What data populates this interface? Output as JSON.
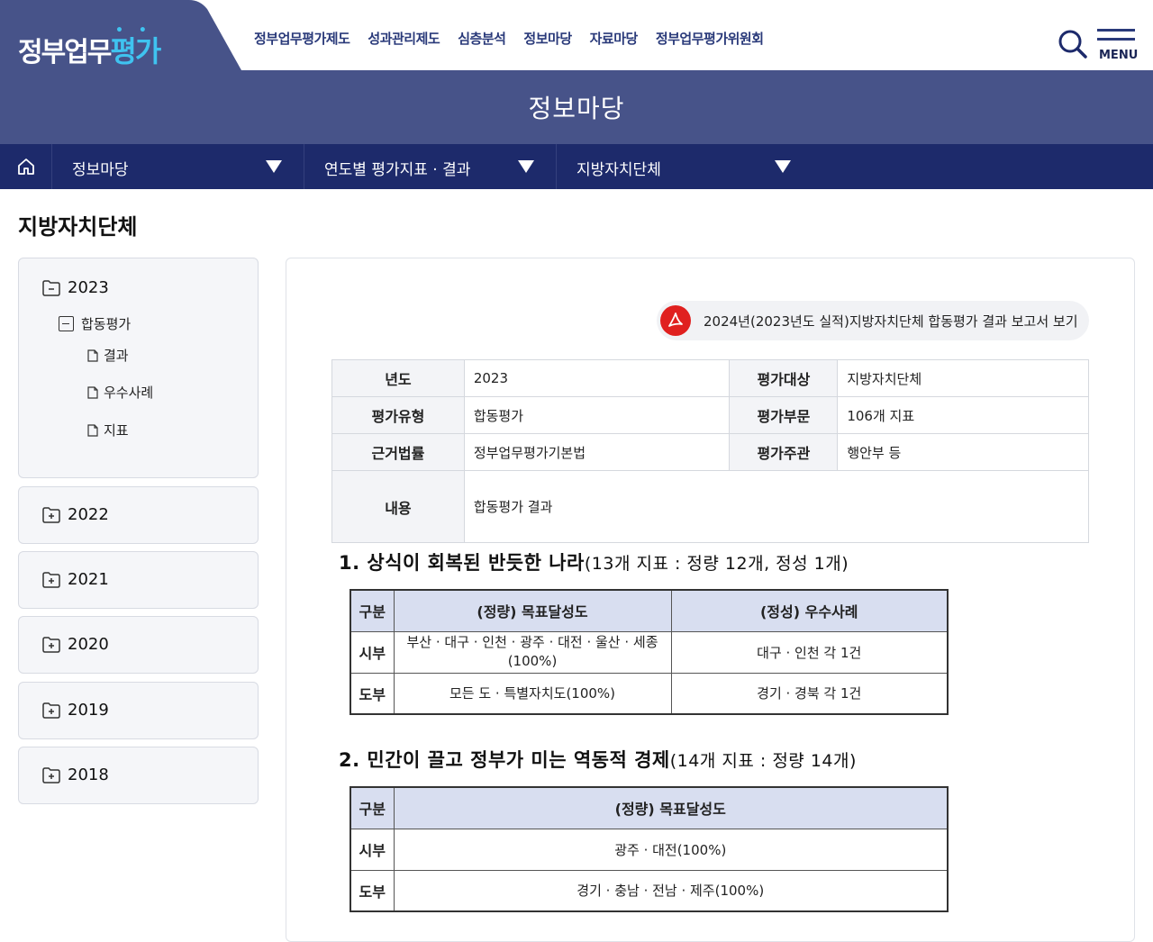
{
  "header": {
    "logo_part1": "정부업무",
    "logo_part2": "평가",
    "nav": [
      "정부업무평가제도",
      "성과관리제도",
      "심층분석",
      "정보마당",
      "자료마당",
      "정부업무평가위원회"
    ],
    "menu_label": "MENU",
    "icons": {
      "search": "search-icon",
      "menu": "hamburger-icon"
    }
  },
  "banner": {
    "title": "정보마당"
  },
  "location": {
    "items": [
      "정보마당",
      "연도별 평가지표 · 결과",
      "지방자치단체"
    ]
  },
  "page_title": "지방자치단체",
  "sidebar": {
    "open_year": "2023",
    "open_sub": "합동평가",
    "leaves": [
      "결과",
      "우수사례",
      "지표"
    ],
    "years": [
      "2022",
      "2021",
      "2020",
      "2019",
      "2018"
    ]
  },
  "report_button": "2024년(2023년도 실적)지방자치단체 합동평가 결과 보고서 보기",
  "info_table": {
    "year_label": "년도",
    "year": "2023",
    "target_label": "평가대상",
    "target": "지방자치단체",
    "type_label": "평가유형",
    "type": "합동평가",
    "section_label": "평가부문",
    "section": "106개 지표",
    "law_label": "근거법률",
    "law": "정부업무평가기본법",
    "host_label": "평가주관",
    "host": "행안부 등",
    "content_label": "내용",
    "content": "합동평가 결과"
  },
  "section1": {
    "title": "1. 상식이 회복된 반듯한 나라",
    "subtitle": "(13개 지표 : 정량 12개, 정성 1개)",
    "head": [
      "구분",
      "(정량) 목표달성도",
      "(정성) 우수사례"
    ],
    "rows": [
      [
        "시부",
        "부산 · 대구 · 인천 · 광주 · 대전 · 울산 · 세종(100%)",
        "대구 · 인천 각 1건"
      ],
      [
        "도부",
        "모든 도 · 특별자치도(100%)",
        "경기 · 경북 각 1건"
      ]
    ]
  },
  "section2": {
    "title": "2. 민간이 끌고 정부가 미는 역동적 경제",
    "subtitle": "(14개 지표 : 정량 14개)",
    "head": [
      "구분",
      "(정량) 목표달성도"
    ],
    "rows": [
      [
        "시부",
        "광주 · 대전(100%)"
      ],
      [
        "도부",
        "경기 · 충남 · 전남 · 제주(100%)"
      ]
    ]
  }
}
